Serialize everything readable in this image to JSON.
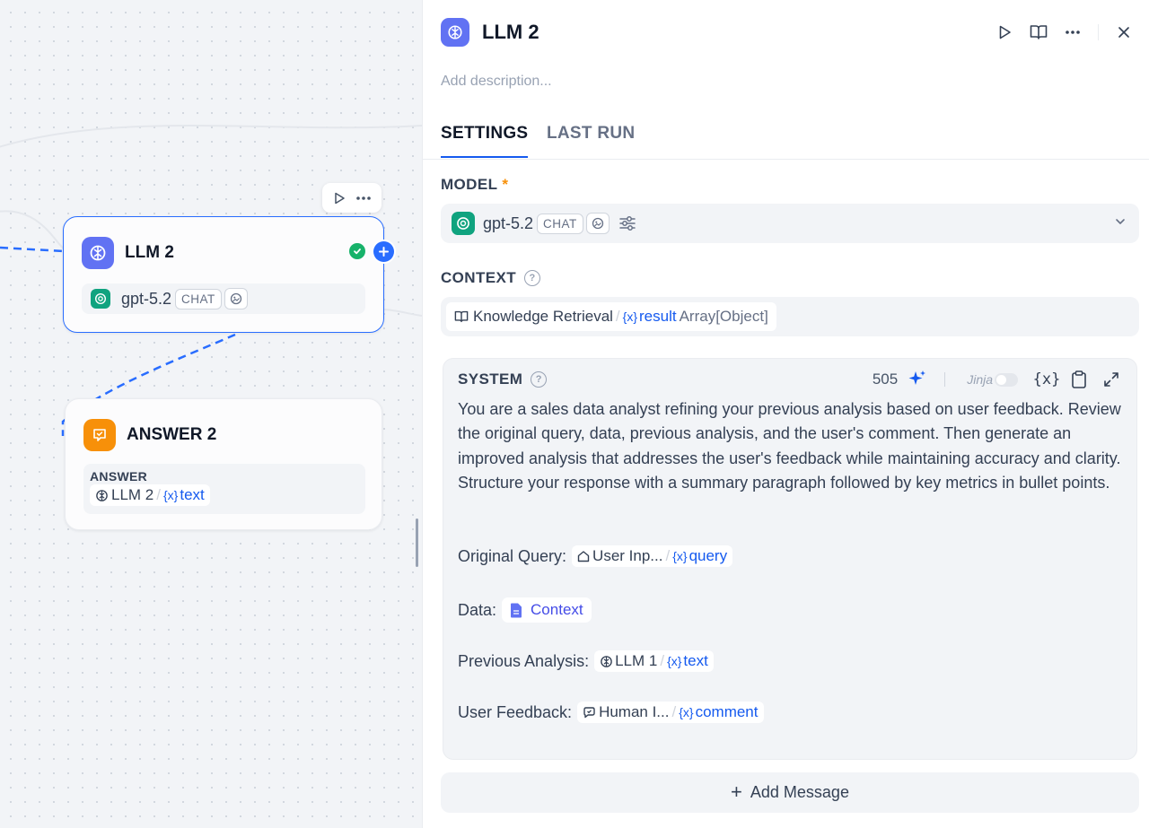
{
  "canvas": {
    "llm_node": {
      "title": "LLM 2",
      "model": "gpt-5.2",
      "model_tag": "CHAT"
    },
    "answer_node": {
      "title": "ANSWER 2",
      "field_label": "ANSWER",
      "var_node": "LLM 2",
      "var_name": "text"
    }
  },
  "panel": {
    "title": "LLM 2",
    "description_placeholder": "Add description...",
    "tabs": [
      {
        "label": "SETTINGS",
        "active": true
      },
      {
        "label": "LAST RUN",
        "active": false
      }
    ],
    "model_section": {
      "label": "MODEL",
      "required_mark": "*",
      "model_name": "gpt-5.2",
      "model_tag": "CHAT"
    },
    "context_section": {
      "label": "CONTEXT",
      "help": "?",
      "var_node": "Knowledge Retrieval",
      "var_name": "result",
      "var_type": "Array[Object]"
    },
    "system": {
      "label": "SYSTEM",
      "help": "?",
      "token_count": "505",
      "jinja_label": "Jinja",
      "jinja_enabled": false,
      "variable_button": "{x}",
      "prompt_text": "You are a sales data analyst refining your previous analysis based on user feedback. Review the original query, data, previous analysis, and the user's comment. Then generate an improved analysis that addresses the user's feedback while maintaining accuracy and clarity. Structure your response with a summary paragraph followed by key metrics in bullet points.",
      "lines": [
        {
          "label": "Original Query:",
          "var_node": "User Inp...",
          "var_name": "query"
        },
        {
          "label": "Data:",
          "context_chip": "Context"
        },
        {
          "label": "Previous Analysis:",
          "var_node": "LLM 1",
          "var_name": "text"
        },
        {
          "label": "User Feedback:",
          "var_node": "Human I...",
          "var_name": "comment"
        }
      ]
    },
    "add_message": {
      "icon": "+",
      "label": "Add Message"
    }
  },
  "colors": {
    "accent": "#155aef",
    "llm_icon": "#6172f3",
    "answer_icon": "#f79009",
    "success": "#17b26a",
    "gpt": "#10a37f"
  }
}
